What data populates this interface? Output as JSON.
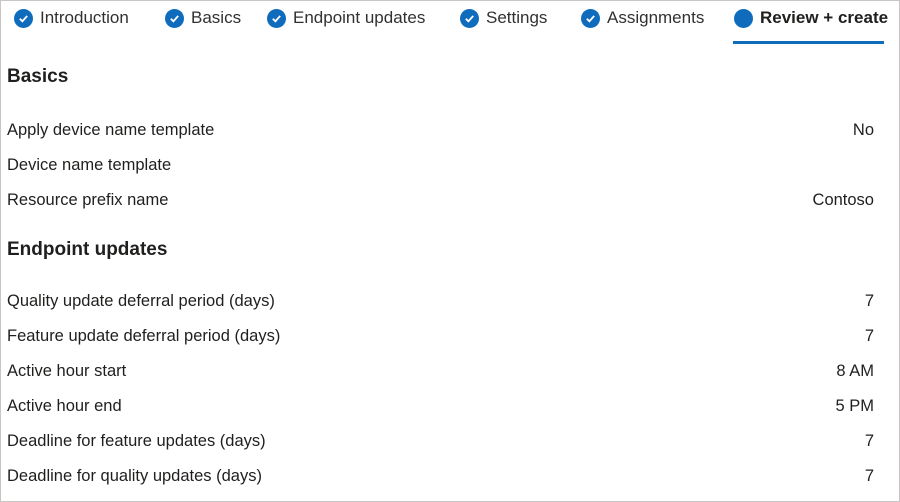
{
  "wizard": {
    "tabs": [
      {
        "label": "Introduction",
        "state": "completed"
      },
      {
        "label": "Basics",
        "state": "completed"
      },
      {
        "label": "Endpoint updates",
        "state": "completed"
      },
      {
        "label": "Settings",
        "state": "completed"
      },
      {
        "label": "Assignments",
        "state": "completed"
      },
      {
        "label": "Review + create",
        "state": "active"
      }
    ],
    "accent_color": "#0f6cbd"
  },
  "basics": {
    "title": "Basics",
    "rows": [
      {
        "label": "Apply device name template",
        "value": "No"
      },
      {
        "label": "Device name template",
        "value": ""
      },
      {
        "label": "Resource prefix name",
        "value": "Contoso"
      }
    ]
  },
  "endpoint_updates": {
    "title": "Endpoint updates",
    "rows": [
      {
        "label": "Quality update deferral period (days)",
        "value": "7"
      },
      {
        "label": "Feature update deferral period (days)",
        "value": "7"
      },
      {
        "label": "Active hour start",
        "value": "8 AM"
      },
      {
        "label": "Active hour end",
        "value": "5 PM"
      },
      {
        "label": "Deadline for feature updates (days)",
        "value": "7"
      },
      {
        "label": "Deadline for quality updates (days)",
        "value": "7"
      }
    ]
  }
}
